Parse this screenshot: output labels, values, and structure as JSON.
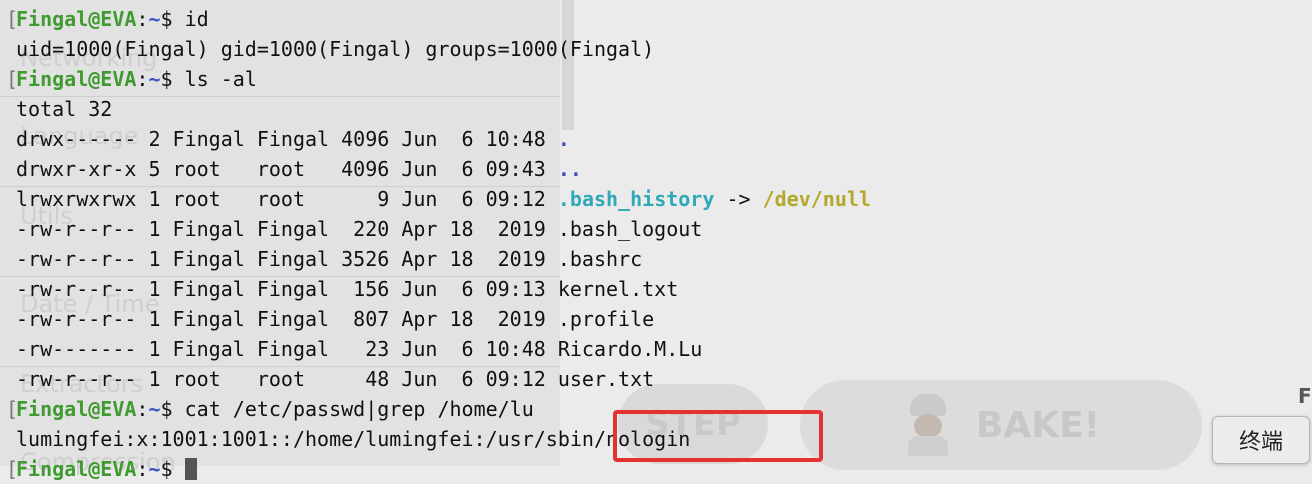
{
  "background_app": {
    "labels": [
      "Networking",
      "Language",
      "Utils",
      "Date / Time",
      "Extractors",
      "Compression"
    ],
    "step_label": "STEP",
    "bake_label": "BAKE!",
    "edge_glyph": "F"
  },
  "terminal": {
    "lines": [
      {
        "kind": "prompt",
        "user": "Fingal@EVA",
        "path": "~",
        "sym": "$ ",
        "cmd": "id"
      },
      {
        "kind": "text",
        "text": "uid=1000(Fingal) gid=1000(Fingal) groups=1000(Fingal)"
      },
      {
        "kind": "prompt",
        "user": "Fingal@EVA",
        "path": "~",
        "sym": "$ ",
        "cmd": "ls -al"
      },
      {
        "kind": "text",
        "text": "total 32"
      },
      {
        "kind": "ls",
        "prefix": "drwx------ 2 Fingal Fingal 4096 Jun  6 10:48 ",
        "name": ".",
        "cls": "dir"
      },
      {
        "kind": "ls",
        "prefix": "drwxr-xr-x 5 root   root   4096 Jun  6 09:43 ",
        "name": "..",
        "cls": "dir"
      },
      {
        "kind": "symlink",
        "prefix": "lrwxrwxrwx 1 root   root      9 Jun  6 09:12 ",
        "name": ".bash_history",
        "arrow": " -> ",
        "target": "/dev/null"
      },
      {
        "kind": "text",
        "text": "-rw-r--r-- 1 Fingal Fingal  220 Apr 18  2019 .bash_logout"
      },
      {
        "kind": "text",
        "text": "-rw-r--r-- 1 Fingal Fingal 3526 Apr 18  2019 .bashrc"
      },
      {
        "kind": "text",
        "text": "-rw-r--r-- 1 Fingal Fingal  156 Jun  6 09:13 kernel.txt"
      },
      {
        "kind": "text",
        "text": "-rw-r--r-- 1 Fingal Fingal  807 Apr 18  2019 .profile"
      },
      {
        "kind": "text",
        "text": "-rw------- 1 Fingal Fingal   23 Jun  6 10:48 Ricardo.M.Lu"
      },
      {
        "kind": "text",
        "text": "-rw-r--r-- 1 root   root     48 Jun  6 09:12 user.txt"
      },
      {
        "kind": "prompt",
        "user": "Fingal@EVA",
        "path": "~",
        "sym": "$ ",
        "cmd": "cat /etc/passwd|grep /home/lu"
      },
      {
        "kind": "text",
        "text": "lumingfei:x:1001:1001::/home/lumingfei:/usr/sbin/nologin"
      },
      {
        "kind": "prompt",
        "user": "Fingal@EVA",
        "path": "~",
        "sym": "$ ",
        "cmd": "",
        "cursor": true
      }
    ],
    "colon": ":",
    "bracket": "["
  },
  "tooltip": {
    "label": "终端"
  },
  "colors": {
    "prompt_user": "#3f9a2f",
    "prompt_path": "#3a50c0",
    "symlink_name": "#2fa9b8",
    "symlink_target": "#b3a82a",
    "highlight": "#e5312f"
  }
}
